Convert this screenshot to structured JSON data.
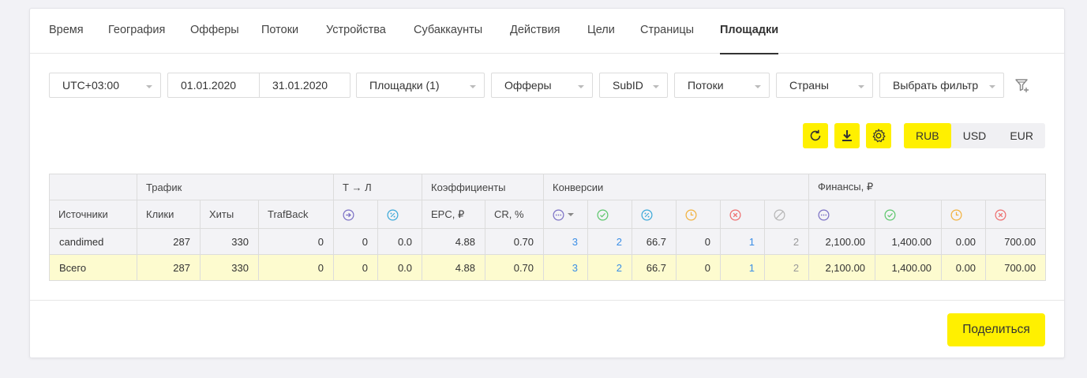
{
  "tabs": [
    "Время",
    "География",
    "Офферы",
    "Потоки",
    "Устройства",
    "Субаккаунты",
    "Действия",
    "Цели",
    "Страницы",
    "Площадки"
  ],
  "filters": {
    "timezone": "UTC+03:00",
    "date_from": "01.01.2020",
    "date_to": "31.01.2020",
    "sites": "Площадки (1)",
    "offers": "Офферы",
    "subid": "SubID",
    "streams": "Потоки",
    "countries": "Страны",
    "choose_filter": "Выбрать фильтр"
  },
  "currency": {
    "options": [
      "RUB",
      "USD",
      "EUR"
    ],
    "selected": "RUB"
  },
  "table": {
    "groups": {
      "traffic": "Трафик",
      "tl": "Т → Л",
      "coef": "Коэффициенты",
      "conv": "Конверсии",
      "fin": "Финансы, ₽"
    },
    "headers": {
      "sources": "Источники",
      "clicks": "Клики",
      "hits": "Хиты",
      "trafback": "TrafBack",
      "epc": "EPC, ₽",
      "cr": "CR, %"
    },
    "rows": [
      {
        "name": "candimed",
        "cells": [
          "287",
          "330",
          "0",
          "0",
          "0.0",
          "4.88",
          "0.70",
          "3",
          "2",
          "66.7",
          "0",
          "1",
          "2",
          "2,100.00",
          "1,400.00",
          "0.00",
          "700.00"
        ]
      },
      {
        "name": "Всего",
        "cells": [
          "287",
          "330",
          "0",
          "0",
          "0.0",
          "4.88",
          "0.70",
          "3",
          "2",
          "66.7",
          "0",
          "1",
          "2",
          "2,100.00",
          "1,400.00",
          "0.00",
          "700.00"
        ]
      }
    ]
  },
  "share_label": "Поделиться",
  "colors": {
    "accent": "#fff000",
    "link": "#3a8ee6",
    "purple": "#7a6fc4",
    "green": "#5cc66b",
    "teal": "#3aa8d8",
    "orange": "#f2b13c",
    "red": "#ee6c6c",
    "gray": "#b5b5b5"
  }
}
